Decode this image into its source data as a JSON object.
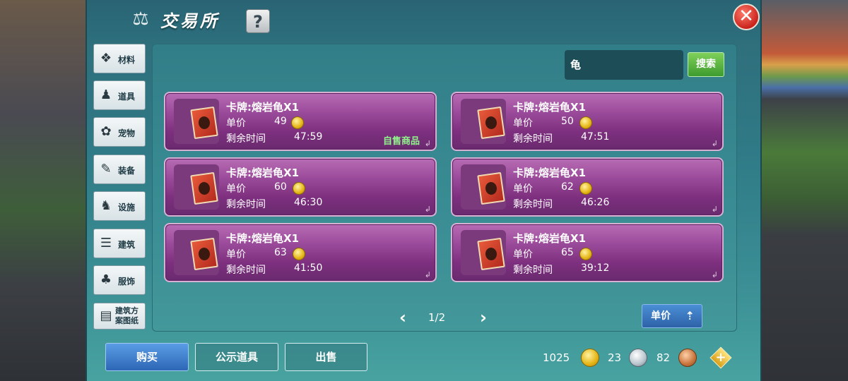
{
  "window": {
    "title": "交易所",
    "help_icon": "?"
  },
  "sidebar": {
    "items": [
      {
        "label": "材料",
        "icon": "materials-icon",
        "glyph": "❖"
      },
      {
        "label": "道具",
        "icon": "item-icon",
        "glyph": "♟"
      },
      {
        "label": "宠物",
        "icon": "paw-icon",
        "glyph": "✿"
      },
      {
        "label": "装备",
        "icon": "equipment-icon",
        "glyph": "✎"
      },
      {
        "label": "设施",
        "icon": "facility-icon",
        "glyph": "♞"
      },
      {
        "label": "建筑",
        "icon": "building-icon",
        "glyph": "☰"
      },
      {
        "label": "服饰",
        "icon": "clothing-icon",
        "glyph": "♣"
      },
      {
        "label": "建筑方案图纸",
        "icon": "blueprint-icon",
        "glyph": "▤"
      }
    ]
  },
  "search": {
    "value": "龟",
    "button_label": "搜索"
  },
  "listings": [
    {
      "name": "卡牌:熔岩龟X1",
      "price_label": "单价",
      "price": "49",
      "time_label": "剩余时间",
      "time": "47:59",
      "tag": "自售商品"
    },
    {
      "name": "卡牌:熔岩龟X1",
      "price_label": "单价",
      "price": "50",
      "time_label": "剩余时间",
      "time": "47:51",
      "tag": ""
    },
    {
      "name": "卡牌:熔岩龟X1",
      "price_label": "单价",
      "price": "60",
      "time_label": "剩余时间",
      "time": "46:30",
      "tag": ""
    },
    {
      "name": "卡牌:熔岩龟X1",
      "price_label": "单价",
      "price": "62",
      "time_label": "剩余时间",
      "time": "46:26",
      "tag": ""
    },
    {
      "name": "卡牌:熔岩龟X1",
      "price_label": "单价",
      "price": "63",
      "time_label": "剩余时间",
      "time": "41:50",
      "tag": ""
    },
    {
      "name": "卡牌:熔岩龟X1",
      "price_label": "单价",
      "price": "65",
      "time_label": "剩余时间",
      "time": "39:12",
      "tag": ""
    }
  ],
  "pager": {
    "text": "1/2"
  },
  "sort": {
    "label": "单价"
  },
  "bottom": {
    "buy_label": "购买",
    "public_label": "公示道具",
    "sell_label": "出售"
  },
  "currency": {
    "gold": "1025",
    "silver": "23",
    "copper": "82"
  },
  "colors": {
    "card": "#9a4a9a",
    "accent_green": "#8ff58a",
    "panel": "#327e88"
  }
}
